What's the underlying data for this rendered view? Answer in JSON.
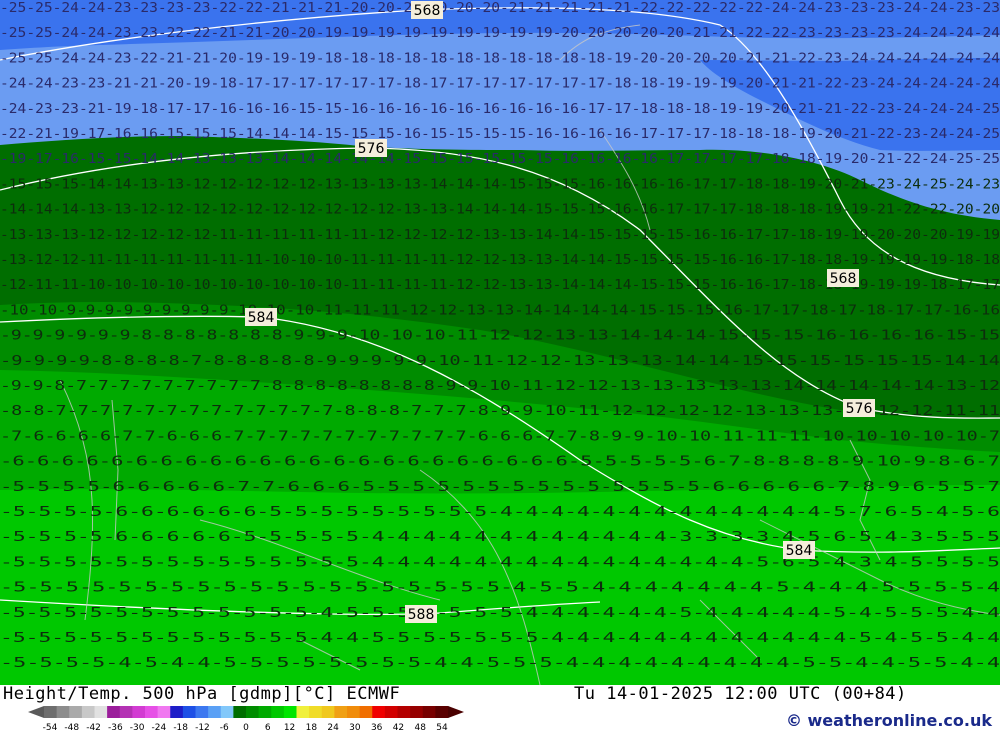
{
  "title": "Height/Temp. 500 hPa [gdmp][°C] ECMWF",
  "timestamp": "Tu 14-01-2025 12:00 UTC (00+84)",
  "credit": "© weatheronline.co.uk",
  "contour_labels": [
    "568",
    "576",
    "584",
    "568",
    "576",
    "584",
    "588"
  ],
  "temperature_rows": [
    "-25-25-24-24-23-23-23-23-22-22-21-21-21-20-20-20-20-20-20-21-21-21-21-21-22-22-22-22-22-24-24-23-23-23-24-24-23-23",
    "-25-25-24-24-23-23-22-22-21-21-20-20-19-19-19-19-19-19-19-19-19-20-20-20-20-20-21-21-22-22-23-23-23-23-24-24-24-24",
    "-25-25-24-24-23-22-21-21-20-19-19-19-18-18-18-18-18-18-18-18-18-18-18-19-20-20-20-20-21-21-22-23-24-24-24-24-24-24",
    "-24-24-23-23-21-21-20-19-18-17-17-17-17-17-17-18-17-17-17-17-17-17-17-18-18-19-19-19-20-21-21-22-23-24-24-24-24-24",
    "-24-23-23-21-19-18-17-17-16-16-16-15-15-16-16-16-16-16-16-16-16-16-17-17-18-18-18-19-19-20-21-21-22-23-24-24-24-25",
    "-22-21-19-17-16-16-15-15-15-14-14-14-15-15-15-16-15-15-15-15-16-16-16-16-17-17-17-18-18-18-19-20-21-22-23-24-24-25",
    "-19-17-16-15-15-14-14-13-13-13-14-14-14-14-14-15-15-15-15-15-15-16-16-16-16-17-17-17-17-18-18-19-20-21-22-24-25-25",
    "-15-15-15-14-14-13-13-12-12-12-12-12-13-13-13-13-14-14-14-15-15-15-16-16-16-16-17-17-18-18-19-20-21-23-24-25-24-23",
    "-14-14-14-13-13-12-12-12-12-12-12-12-12-12-12-13-13-14-14-14-15-15-15-16-16-17-17-17-18-18-18-19-19-21-22-22-20-20",
    "-13-13-13-12-12-12-12-12-11-11-11-11-11-11-12-12-12-12-13-13-14-14-15-15-15-15-16-16-17-17-18-19-19-20-20-20-19-19",
    "-13-12-12-11-11-11-11-11-11-11-10-10-10-11-11-11-11-12-12-13-13-14-14-15-15-15-15-16-16-17-18-18-19-19-19-19-18-18",
    "-12-11-11-10-10-10-10-10-10-10-10-10-10-11-11-11-11-12-12-13-13-14-14-14-15-15-15-16-16-17-18-18-19-19-19-18-17-17",
    "-10-10-9-9-9-9-9-9-9-9-9-10-10-10-11-11-11-12-12-13-13-14-14-14-14-15-15-15-16-17-17-18-17-18-17-17-16-16",
    "-9-9-9-9-9-9-8-8-8-8-8-8-8-9-9-9-10-10-10-11-12-12-13-13-14-14-14-15-15-15-16-16-16-16-15-15",
    "-9-9-9-9-8-8-8-8-7-8-8-8-8-8-9-9-9-9-9-10-11-12-12-13-13-13-14-14-15-15-15-15-15-15-14-14",
    "-9-9-8-7-7-7-7-7-7-7-7-7-8-8-8-8-8-8-8-8-9-9-10-11-12-12-13-13-13-13-13-14-14-14-14-14-13-12",
    "-8-8-7-7-7-7-7-7-7-7-7-7-7-7-7-8-8-8-7-7-7-8-9-9-10-11-12-12-12-12-13-13-13-12-12-12-11-11",
    "-7-6-6-6-6-7-7-6-6-6-7-7-7-7-7-7-7-7-7-7-7-6-6-6-7-7-8-9-9-10-10-11-11-11-10-10-10-10-10-7",
    "-6-6-6-6-6-6-6-6-6-6-6-6-6-6-6-6-6-6-6-6-6-6-6-5-5-5-5-5-6-7-8-8-8-8-9-10-9-8-6-7",
    "-5-5-5-5-6-6-6-6-6-7-7-6-6-6-5-5-5-5-5-5-5-5-5-5-5-5-5-5-6-6-6-6-6-7-8-9-6-5-5-7",
    "-5-5-5-5-6-6-6-6-6-6-5-5-5-5-5-5-5-5-5-4-4-4-4-4-4-4-4-4-4-4-4-4-5-7-6-5-4-5-6",
    "-5-5-5-5-6-6-6-6-6-5-5-5-5-5-4-4-4-4-4-4-4-4-4-4-4-4-3-3-3-3-4-5-6-5-4-3-5-5-5",
    "-5-5-5-5-5-5-5-5-5-5-5-5-5-5-4-4-4-4-4-4-4-4-4-4-4-4-4-4-4-5-6-5-4-3-4-5-5-5-5",
    "-5-5-5-5-5-5-5-5-5-5-5-5-5-5-5-5-5-5-5-4-5-5-4-4-4-4-4-4-4-5-4-4-4-5-5-5-5-4",
    "-5-5-5-5-5-5-5-5-5-5-5-5-4-5-5-5-5-5-5-5-4-4-4-4-4-4-5-4-4-4-4-4-5-4-5-5-5-4-4",
    "-5-5-5-5-5-5-5-5-5-5-5-5-4-4-5-5-5-5-5-5-5-4-4-4-4-4-4-4-4-4-4-4-4-5-4-5-5-4-4",
    "-5-5-5-5-4-5-4-4-5-5-5-5-5-5-5-5-4-4-5-5-5-4-4-4-4-4-4-4-4-4-5-5-4-4-5-5-4-4"
  ],
  "legend": {
    "colors": [
      "#6e6e6e",
      "#8c8c8c",
      "#aaaaaa",
      "#c8c8c8",
      "#e1e1e1",
      "#9b1e9b",
      "#b432b4",
      "#d23cd2",
      "#e650e6",
      "#f078f0",
      "#1e1ec8",
      "#1e50e6",
      "#3c78f0",
      "#5aa0f5",
      "#82c8fa",
      "#006e00",
      "#008c00",
      "#00aa00",
      "#00c800",
      "#00e600",
      "#f0f03c",
      "#f0dc28",
      "#f0c81e",
      "#f0a014",
      "#f08c0a",
      "#f06e00",
      "#f00000",
      "#d20000",
      "#b40000",
      "#960000",
      "#780000",
      "#5a0000"
    ],
    "labels": [
      "-54",
      "-48",
      "-42",
      "-36",
      "-30",
      "-24",
      "-18",
      "-12",
      "-6",
      "0",
      "6",
      "12",
      "18",
      "24",
      "30",
      "36",
      "42",
      "48",
      "54"
    ]
  }
}
